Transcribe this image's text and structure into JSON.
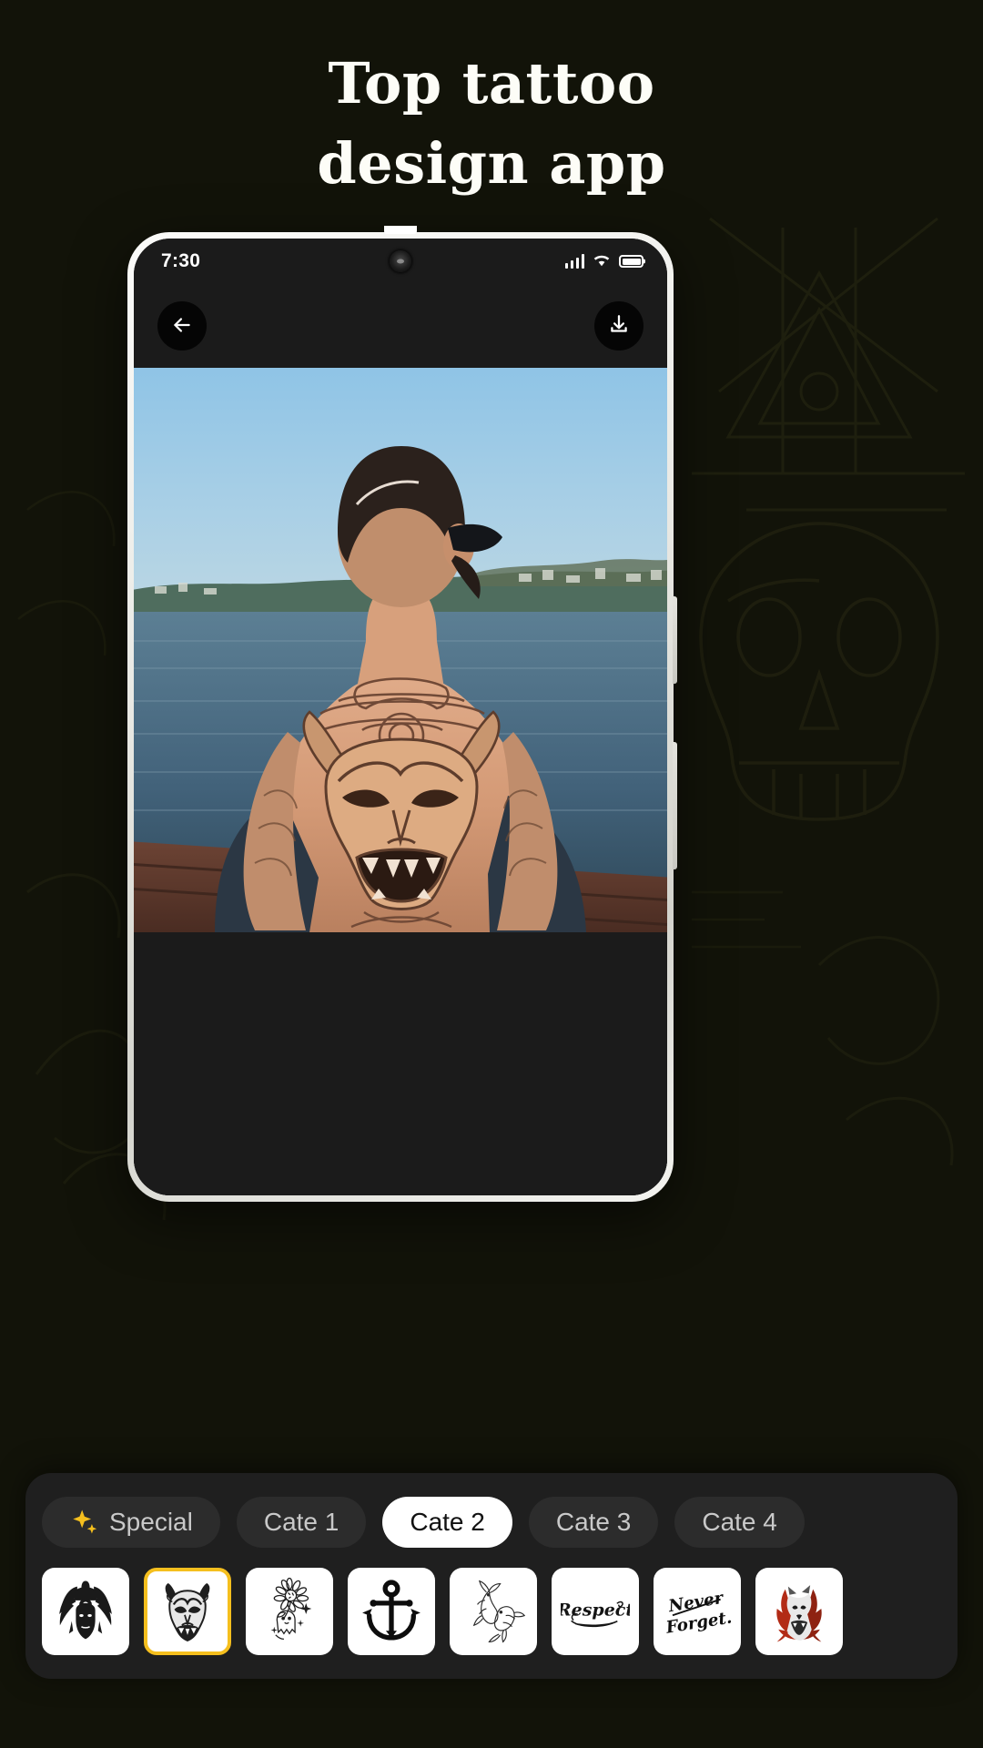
{
  "promo": {
    "headline_line1": "Top tattoo",
    "headline_line2": "design app",
    "background_color": "#121309",
    "text_color": "#fdfdf7"
  },
  "phone": {
    "frame_color": "#f2f2ee",
    "screen_background": "#1b1b1b"
  },
  "status_bar": {
    "time": "7:30",
    "signal_icon": "cellular-signal-icon",
    "wifi_icon": "wifi-icon",
    "battery_icon": "battery-full-icon",
    "camera_icon": "front-camera-icon"
  },
  "toolbar": {
    "back_icon": "arrow-left-icon",
    "download_icon": "download-icon"
  },
  "preview": {
    "description": "Man with large hannya oni mask back tattoo sitting by the water",
    "sky_color": "#8cbfe0",
    "water_color": "#4d6f85",
    "skin_color": "#d9a382"
  },
  "bottom_panel": {
    "background": "#1f1f1f",
    "categories": [
      {
        "label": "Special",
        "icon": "sparkle-icon",
        "selected": false
      },
      {
        "label": "Cate 1",
        "icon": null,
        "selected": false
      },
      {
        "label": "Cate 2",
        "icon": null,
        "selected": true
      },
      {
        "label": "Cate 3",
        "icon": null,
        "selected": false
      },
      {
        "label": "Cate 4",
        "icon": null,
        "selected": false
      }
    ],
    "selected_category": "Cate 2",
    "accent_color": "#f5bf1e",
    "thumbnails": [
      {
        "name": "native-chief-headdress",
        "selected": false
      },
      {
        "name": "hannya-oni-mask",
        "selected": true
      },
      {
        "name": "flower-ghost",
        "selected": false
      },
      {
        "name": "anchor",
        "selected": false
      },
      {
        "name": "koi-fish",
        "selected": false
      },
      {
        "name": "respect-lettering",
        "label": "Respect",
        "selected": false
      },
      {
        "name": "never-forget-lettering",
        "label": "Never Forget",
        "selected": false
      },
      {
        "name": "red-wolf",
        "selected": false
      }
    ]
  }
}
